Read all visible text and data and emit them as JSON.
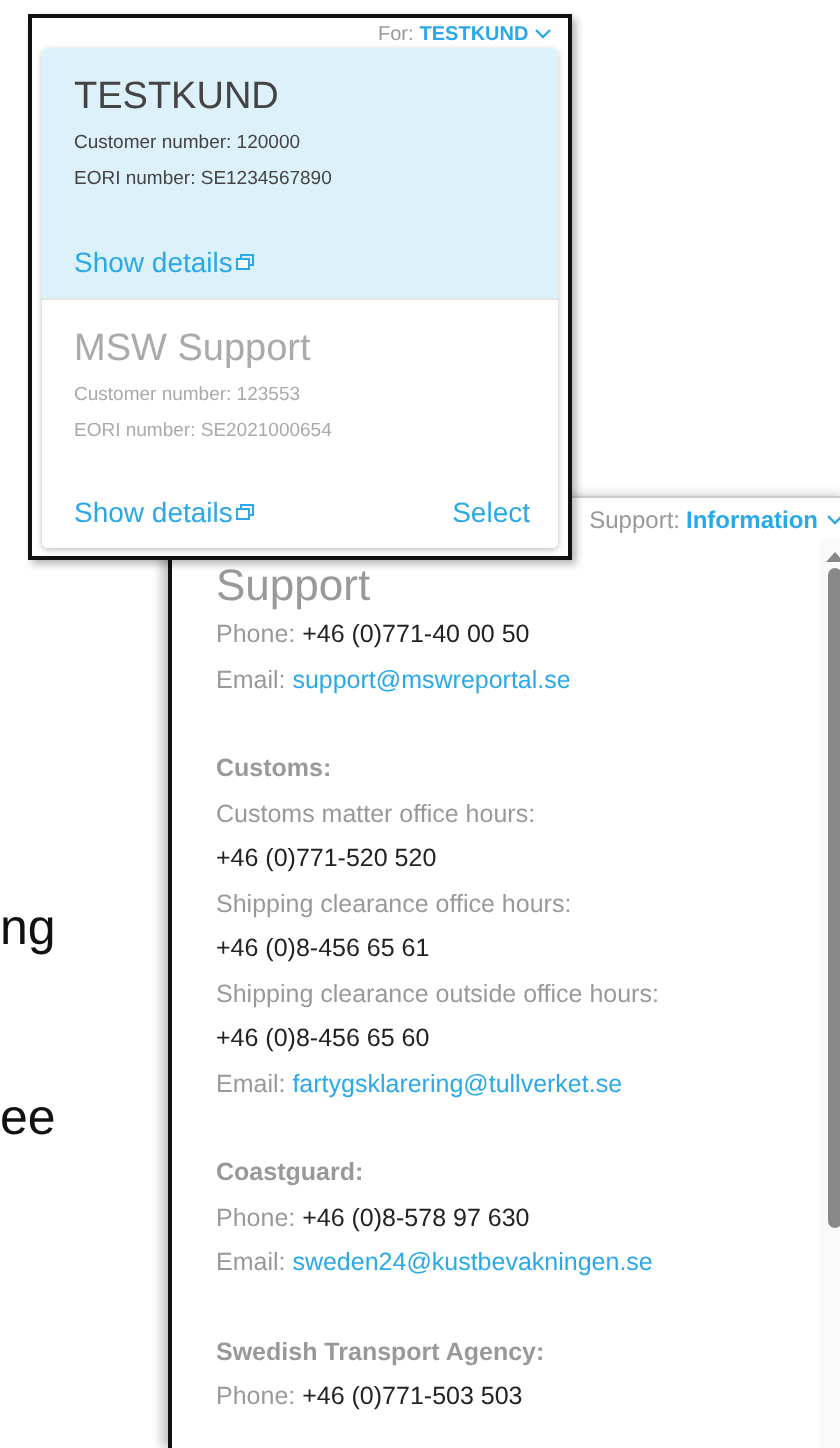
{
  "background_texts": [
    "ng",
    "ee"
  ],
  "customer_menu": {
    "label": "For:",
    "value": "TESTKUND",
    "customers": [
      {
        "name": "TESTKUND",
        "customer_number": "Customer number: 120000",
        "eori_number": "EORI number: SE1234567890",
        "details_link": "Show details",
        "selected": true
      },
      {
        "name": "MSW Support",
        "customer_number": "Customer number: 123553",
        "eori_number": "EORI number: SE2021000654",
        "details_link": "Show details",
        "select_link": "Select",
        "selected": false
      }
    ]
  },
  "info_panel": {
    "label": "Support:",
    "value": "Information",
    "title": "Support",
    "sections": [
      {
        "lines": [
          {
            "kind": "field",
            "label": "Phone:",
            "value": "+46 (0)771-40 00 50"
          },
          {
            "kind": "email",
            "label": "Email:",
            "value": "support@mswreportal.se"
          }
        ]
      },
      {
        "heading": "Customs:",
        "lines": [
          {
            "kind": "note",
            "value": "Customs matter office hours:"
          },
          {
            "kind": "number",
            "value": "+46 (0)771-520 520"
          },
          {
            "kind": "note",
            "value": "Shipping clearance office hours:"
          },
          {
            "kind": "number",
            "value": "+46 (0)8-456 65 61"
          },
          {
            "kind": "note",
            "value": "Shipping clearance outside office hours:"
          },
          {
            "kind": "number",
            "value": "+46 (0)8-456 65 60"
          },
          {
            "kind": "email",
            "label": "Email:",
            "value": "fartygsklarering@tullverket.se"
          }
        ]
      },
      {
        "heading": "Coastguard:",
        "lines": [
          {
            "kind": "field",
            "label": "Phone:",
            "value": "+46 (0)8-578 97 630"
          },
          {
            "kind": "email",
            "label": "Email:",
            "value": "sweden24@kustbevakningen.se"
          }
        ]
      },
      {
        "heading": "Swedish Transport Agency:",
        "lines": [
          {
            "kind": "field",
            "label": "Phone:",
            "value": "+46 (0)771-503 503"
          }
        ]
      }
    ]
  }
}
